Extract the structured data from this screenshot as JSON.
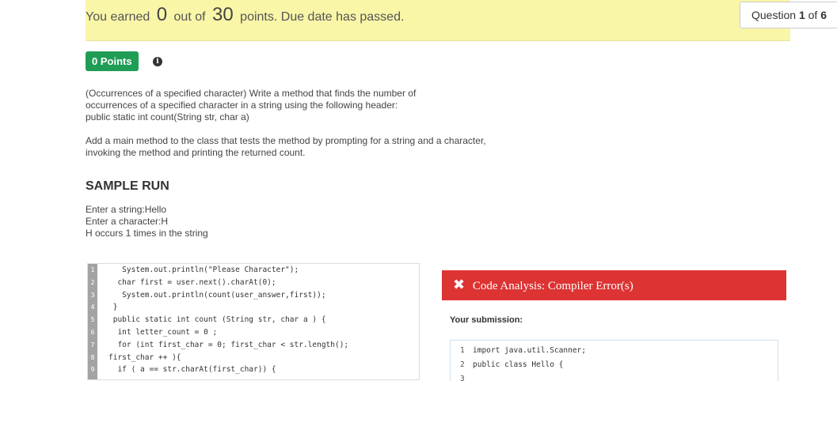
{
  "banner": {
    "prefix": "You earned",
    "earned": "0",
    "middle": "out of",
    "total": "30",
    "suffix": "points. Due date has passed."
  },
  "question_select": {
    "prefix": "Question",
    "current": "1",
    "of": "of",
    "total": "6"
  },
  "points_badge": "0 Points",
  "info_icon_glyph": "i",
  "description": {
    "paragraph1": "(Occurrences of a specified character) Write a method that finds the number of\noccurrences of a specified character in a string using the following header:\npublic static int count(String str, char a)",
    "paragraph2": "Add a main method to the class that tests the method by prompting for a string and a character,\ninvoking the method and printing the returned count."
  },
  "sample_run": {
    "title": "SAMPLE RUN",
    "lines": [
      "Enter a string:Hello",
      "Enter a character:H",
      "H occurs 1 times in the string"
    ]
  },
  "editor": {
    "line_numbers": [
      "1",
      "2",
      "3",
      "4",
      "5",
      "6",
      "7",
      "8",
      "9"
    ],
    "lines": [
      "   System.out.println(\"Please Character\");",
      "  char first = user.next().charAt(0);",
      "   System.out.println(count(user_answer,first));",
      " }",
      " public static int count (String str, char a ) {",
      "  int letter_count = 0 ;",
      "  for (int first_char = 0; first_char < str.length();",
      "first_char ++ ){",
      "  if ( a == str.charAt(first_char)) {"
    ]
  },
  "error_bar": {
    "icon": "x-icon",
    "glyph": "✖",
    "label": "Code Analysis: Compiler Error(s)",
    "color": "#dd3333"
  },
  "your_submission": {
    "label": "Your submission:",
    "lines": [
      {
        "num": "1",
        "code": "import java.util.Scanner;"
      },
      {
        "num": "2",
        "code": "public class Hello {"
      },
      {
        "num": "3",
        "code": ""
      }
    ]
  },
  "colors": {
    "banner_bg": "#f9f6a8",
    "points_badge": "#1f9d55",
    "error": "#dd3333",
    "gutter": "#a3a3a3"
  }
}
